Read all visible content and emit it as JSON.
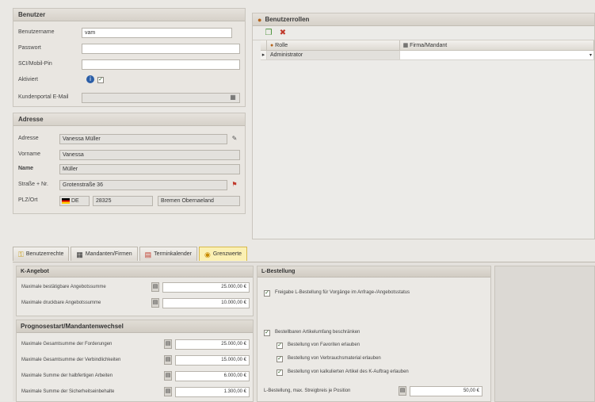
{
  "benutzer": {
    "title": "Benutzer",
    "fields": {
      "benutzername_label": "Benutzername",
      "benutzername_value": "vam",
      "passwort_label": "Passwort",
      "sci_label": "SCI/Mobil-Pin",
      "aktiviert_label": "Aktiviert",
      "kundenportal_label": "Kundenportal E-Mail"
    }
  },
  "adresse": {
    "title": "Adresse",
    "adresse_label": "Adresse",
    "adresse_value": "Vanessa Müller",
    "vorname_label": "Vorname",
    "vorname_value": "Vanessa",
    "name_label": "Name",
    "name_value": "Müller",
    "strasse_label": "Straße + Nr.",
    "strasse_value": "Grotenstraße 36",
    "plz_label": "PLZ/Ort",
    "country_value": "DE",
    "plz_value": "28325",
    "ort_value": "Bremen Obernaeland"
  },
  "rollen": {
    "title": "Benutzerrollen",
    "col_rolle": "Rolle",
    "col_firma": "Firma/Mandant",
    "row_value": "Administrator"
  },
  "tabs": [
    {
      "label": "Benutzerrechte",
      "icon": "key-icon"
    },
    {
      "label": "Mandanten/Firmen",
      "icon": "grid-icon"
    },
    {
      "label": "Terminkalender",
      "icon": "calendar-icon"
    },
    {
      "label": "Grenzwerte",
      "icon": "coins-icon"
    }
  ],
  "angebot": {
    "title": "K-Angebot",
    "rows": [
      {
        "label": "Maximale bestätigbare Angebotssumme",
        "value": "25.000,00 €"
      },
      {
        "label": "Maximale druckbare Angebotssumme",
        "value": "10.000,00 €"
      }
    ]
  },
  "prognose": {
    "title": "Prognosestart/Mandantenwechsel",
    "rows": [
      {
        "label": "Maximale Gesamtsumme der Forderungen",
        "value": "25.000,00 €"
      },
      {
        "label": "Maximale Gesamtsumme der Verbindlichkeiten",
        "value": "15.000,00 €"
      },
      {
        "label": "Maximale Summe der halbfertigen Arbeiten",
        "value": "6.000,00 €"
      },
      {
        "label": "Maximale Summe der Sicherheitseinbehalte",
        "value": "1.300,00 €"
      }
    ]
  },
  "lbestellung": {
    "title": "L-Bestellung",
    "freigabe_label": "Freigabe L-Bestellung für Vorgänge im Anfrage-/Angebotsstatus",
    "artikel_label": "Bestellbaren Artikelumfang beschränken",
    "sub1": "Bestellung von Favoriten erlauben",
    "sub2": "Bestellung von Verbrauchsmaterial erlauben",
    "sub3": "Bestellung von kalkulierten Artikel des K-Auftrag erlauben",
    "max_label": "L-Bestellung, max. Streigbreis je Position",
    "max_value": "50,00 €"
  }
}
